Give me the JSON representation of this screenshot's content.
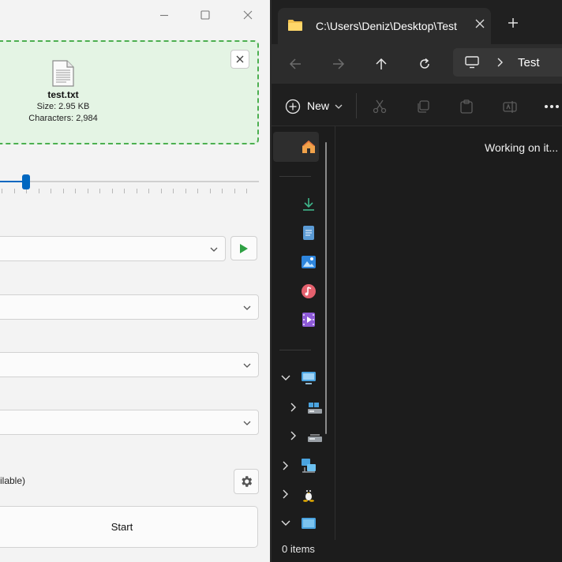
{
  "app": {
    "file": {
      "name": "test.txt",
      "size": "Size: 2.95 KB",
      "characters": "Characters: 2,984"
    },
    "slider": {
      "value_fraction": 0.1
    },
    "status_text": "ilable)",
    "start_label": "Start"
  },
  "explorer": {
    "tab_title": "C:\\Users\\Deniz\\Desktop\\Test",
    "address_segment": "Test",
    "new_label": "New",
    "body_message": "Working on it...",
    "status_items": "0 items"
  },
  "colors": {
    "accent": "#0067c0",
    "dropzone_bg": "#e4f4e4",
    "dropzone_border": "#4caf50",
    "play_green": "#2ea043",
    "explorer_bg": "#1c1c1c"
  },
  "icons": [
    "minimize-icon",
    "maximize-icon",
    "close-icon",
    "file-icon",
    "chevron-down-icon",
    "play-icon",
    "gear-icon",
    "folder-icon",
    "plus-icon",
    "back-arrow-icon",
    "forward-arrow-icon",
    "up-arrow-icon",
    "refresh-icon",
    "monitor-icon",
    "chevron-right-icon",
    "new-icon",
    "cut-icon",
    "copy-icon",
    "paste-icon",
    "rename-icon",
    "more-icon",
    "home-icon",
    "downloads-icon",
    "documents-icon",
    "pictures-icon",
    "music-icon",
    "videos-icon",
    "this-pc-icon",
    "drive-icon",
    "network-icon",
    "linux-icon"
  ]
}
